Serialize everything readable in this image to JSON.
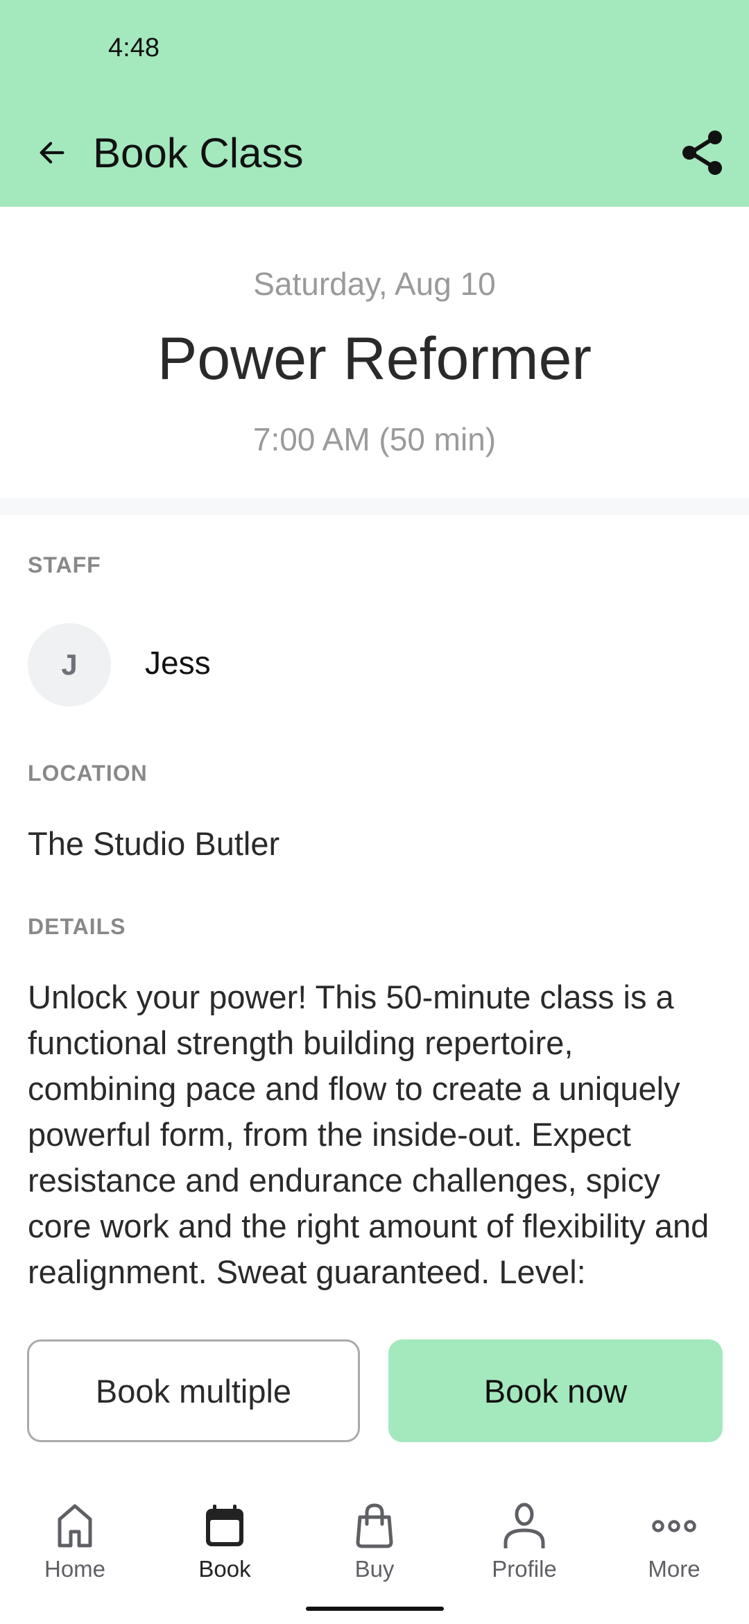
{
  "status_bar": {
    "time": "4:48"
  },
  "header": {
    "title": "Book Class",
    "back_icon": "arrow-left-icon",
    "share_icon": "share-icon",
    "background_color": "#a4e8be"
  },
  "class": {
    "date": "Saturday, Aug 10",
    "name": "Power Reformer",
    "time": "7:00 AM (50 min)"
  },
  "staff": {
    "label": "STAFF",
    "initial": "J",
    "name": "Jess"
  },
  "location": {
    "label": "LOCATION",
    "name": "The Studio Butler"
  },
  "details": {
    "label": "DETAILS",
    "text": "Unlock your power! This 50-minute class is a functional strength building repertoire, combining pace and flow to create a uniquely powerful form, from the inside-out. Expect resistance and endurance challenges, spicy core work and the right amount of flexibility and realignment. Sweat guaranteed. Level:"
  },
  "actions": {
    "book_multiple": "Book multiple",
    "book_now": "Book now"
  },
  "bottom_nav": {
    "active": "Book",
    "items": [
      {
        "label": "Home",
        "icon": "home-icon"
      },
      {
        "label": "Book",
        "icon": "calendar-icon"
      },
      {
        "label": "Buy",
        "icon": "shopping-bag-icon"
      },
      {
        "label": "Profile",
        "icon": "person-icon"
      },
      {
        "label": "More",
        "icon": "more-dots-icon"
      }
    ]
  }
}
